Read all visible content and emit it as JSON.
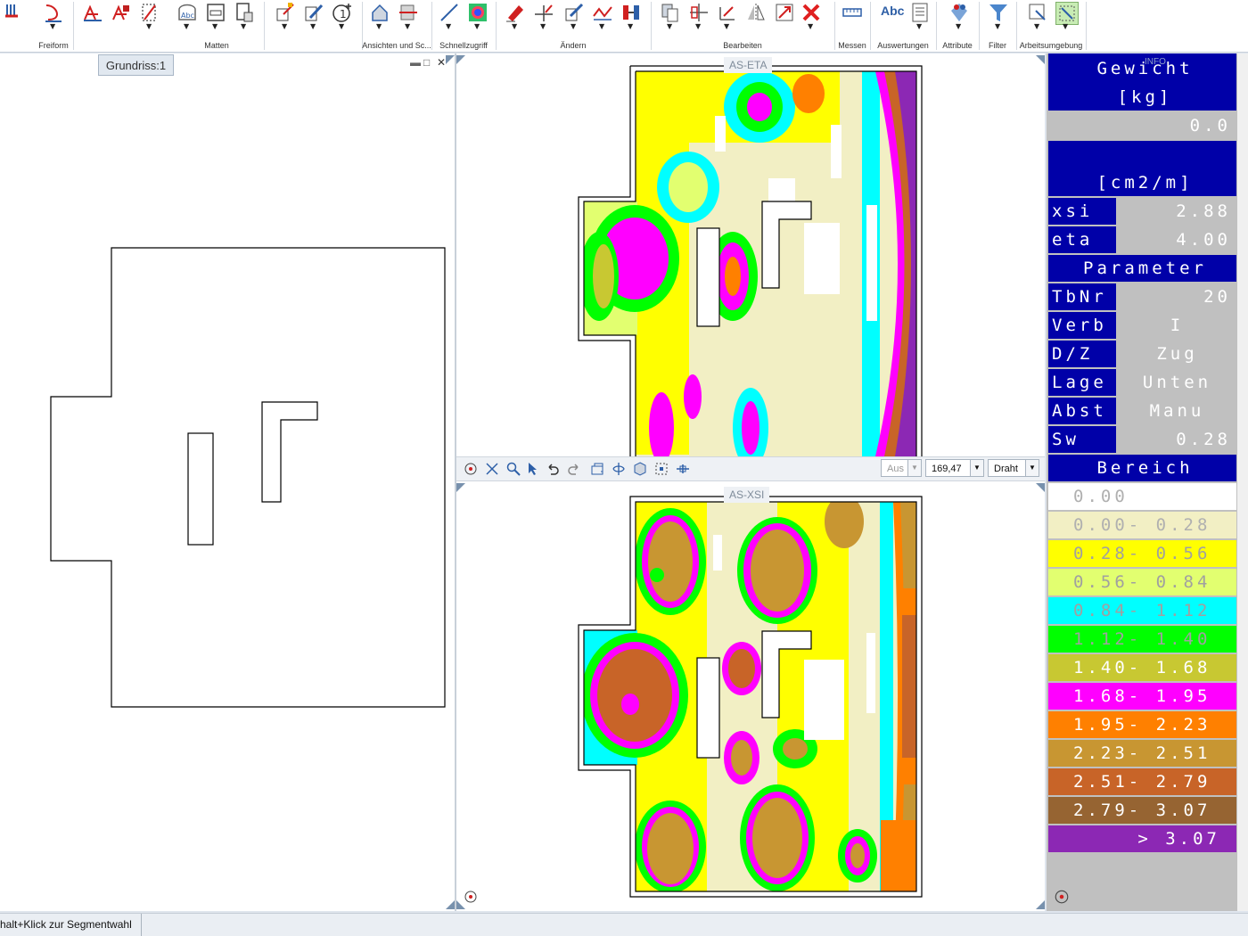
{
  "ribbon": {
    "groups": [
      {
        "label": "Freiform"
      },
      {
        "label": "Matten"
      },
      {
        "label": "Ansichten und Sc..."
      },
      {
        "label": "Schnellzugriff"
      },
      {
        "label": "Ändern"
      },
      {
        "label": "Bearbeiten"
      },
      {
        "label": "Messen"
      },
      {
        "label": "Auswertungen"
      },
      {
        "label": "Attribute"
      },
      {
        "label": "Filter"
      },
      {
        "label": "Arbeitsumgebung"
      }
    ],
    "abc_label": "Abc",
    "abc_small_label": "Abc"
  },
  "left_view": {
    "tab": "Grundriss:1"
  },
  "eta_view": {
    "title": "AS-ETA"
  },
  "xsi_view": {
    "title": "AS-XSI"
  },
  "view_toolbar": {
    "mode_value": "Aus",
    "scale_value": "169,47",
    "render_value": "Draht"
  },
  "info_panel": {
    "badge": "INFO",
    "weight_title_1": "Gewicht",
    "weight_title_2": "[kg]",
    "weight_value": "0.0",
    "unit": "[cm2/m]",
    "xsi_label": "xsi",
    "xsi_value": "2.88",
    "eta_label": "eta",
    "eta_value": "4.00",
    "params_title": "Parameter",
    "params": [
      {
        "label": "TbNr",
        "value": "20"
      },
      {
        "label": "Verb",
        "value": "I"
      },
      {
        "label": "D/Z",
        "value": "Zug"
      },
      {
        "label": "Lage",
        "value": "Unten"
      },
      {
        "label": "Abst",
        "value": "Manu"
      },
      {
        "label": "Sw",
        "value": "0.28"
      }
    ],
    "range_title": "Bereich",
    "legend": [
      {
        "text": "0.00",
        "color": "#ffffff",
        "textcolor": "#b0b0b0"
      },
      {
        "text": "0.00- 0.28",
        "color": "#f2efc4",
        "textcolor": "#b0b0b0"
      },
      {
        "text": "0.28- 0.56",
        "color": "#ffff00",
        "textcolor": "#a0a0a0"
      },
      {
        "text": "0.56- 0.84",
        "color": "#e2ff70",
        "textcolor": "#a0a0a0"
      },
      {
        "text": "0.84- 1.12",
        "color": "#00ffff",
        "textcolor": "#a0a0a0"
      },
      {
        "text": "1.12- 1.40",
        "color": "#00ff00",
        "textcolor": "#a0a0a0"
      },
      {
        "text": "1.40- 1.68",
        "color": "#c8c832",
        "textcolor": "#ffffff"
      },
      {
        "text": "1.68- 1.95",
        "color": "#ff00ff",
        "textcolor": "#ffffff"
      },
      {
        "text": "1.95- 2.23",
        "color": "#ff8000",
        "textcolor": "#ffffff"
      },
      {
        "text": "2.23- 2.51",
        "color": "#c89632",
        "textcolor": "#ffffff"
      },
      {
        "text": "2.51- 2.79",
        "color": "#c86428",
        "textcolor": "#ffffff"
      },
      {
        "text": "2.79- 3.07",
        "color": "#966432",
        "textcolor": "#ffffff"
      },
      {
        "text": "> 3.07",
        "color": "#8c28b4",
        "textcolor": "#ffffff"
      }
    ]
  },
  "status_bar": {
    "text": "halt+Klick zur Segmentwahl"
  },
  "colors": {
    "panel_blue": "#0000a8",
    "panel_grey": "#c0c0c0"
  }
}
